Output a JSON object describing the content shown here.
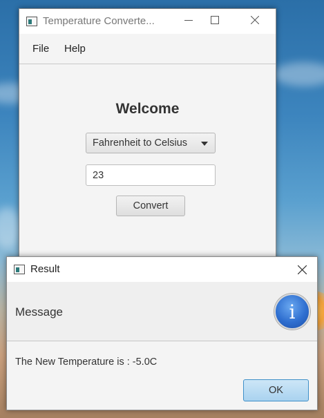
{
  "main_window": {
    "title": "Temperature Converte...",
    "menu": [
      "File",
      "Help"
    ],
    "heading": "Welcome",
    "conversion_select": {
      "selected": "Fahrenheit to Celsius"
    },
    "input_value": "23",
    "convert_label": "Convert"
  },
  "result_dialog": {
    "title": "Result",
    "header_text": "Message",
    "content_text": "The New Temperature is : -5.0C",
    "ok_label": "OK",
    "icon": "info-icon"
  },
  "colors": {
    "window_bg": "#f4f4f4",
    "ok_accent": "#3e8fc8",
    "info_icon_blue": "#2f6fd0"
  }
}
